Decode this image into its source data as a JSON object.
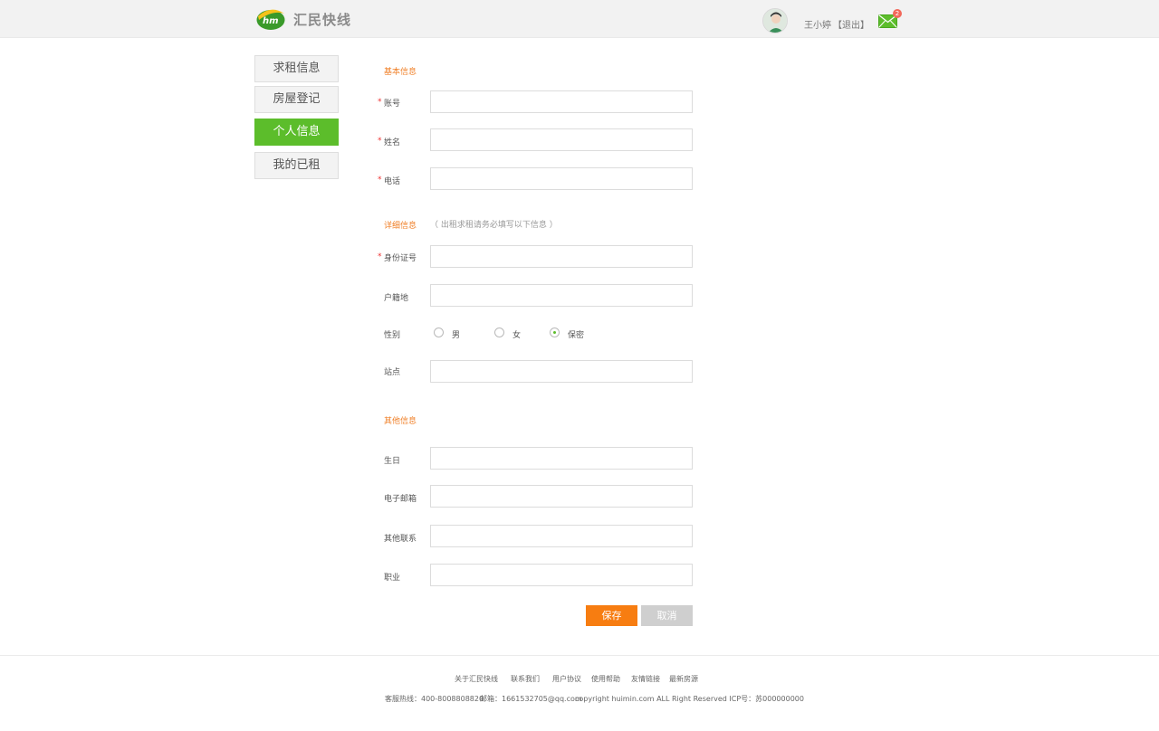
{
  "header": {
    "logo_text": "汇民快线",
    "username": "王小婷",
    "logout": "【退出】",
    "mail_count": "2"
  },
  "sidebar": {
    "items": [
      {
        "label": "求租信息"
      },
      {
        "label": "房屋登记"
      },
      {
        "label": "个人信息"
      },
      {
        "label": "我的已租"
      }
    ]
  },
  "form": {
    "basic_title": "基本信息",
    "detail_title": "详细信息",
    "detail_note": "（ 出租求租请务必填写以下信息 ）",
    "other_title": "其他信息",
    "fields": {
      "account": "账号",
      "name": "姓名",
      "phone": "电话",
      "id_number": "身份证号",
      "hometown": "户籍地",
      "gender": "性别",
      "station": "站点",
      "birthday": "生日",
      "email": "电子邮箱",
      "other_contact": "其他联系",
      "occupation": "职业"
    },
    "required_mark": "*",
    "gender_options": [
      "男",
      "女",
      "保密"
    ],
    "gender_selected": "保密",
    "save_label": "保存",
    "cancel_label": "取消"
  },
  "footer": {
    "links": [
      "关于汇民快线",
      "联系我们",
      "用户协议",
      "使用帮助",
      "友情链接",
      "最新房源"
    ],
    "hotline": "客服热线：400-8008808820",
    "email": "邮箱：1661532705@qq.com",
    "copyright": "copyright  huimin.com ALL Right Reserved ICP号：苏000000000"
  },
  "colors": {
    "accent_green": "#5cbd2b",
    "accent_orange": "#f77d11",
    "section_title": "#f0812a"
  }
}
